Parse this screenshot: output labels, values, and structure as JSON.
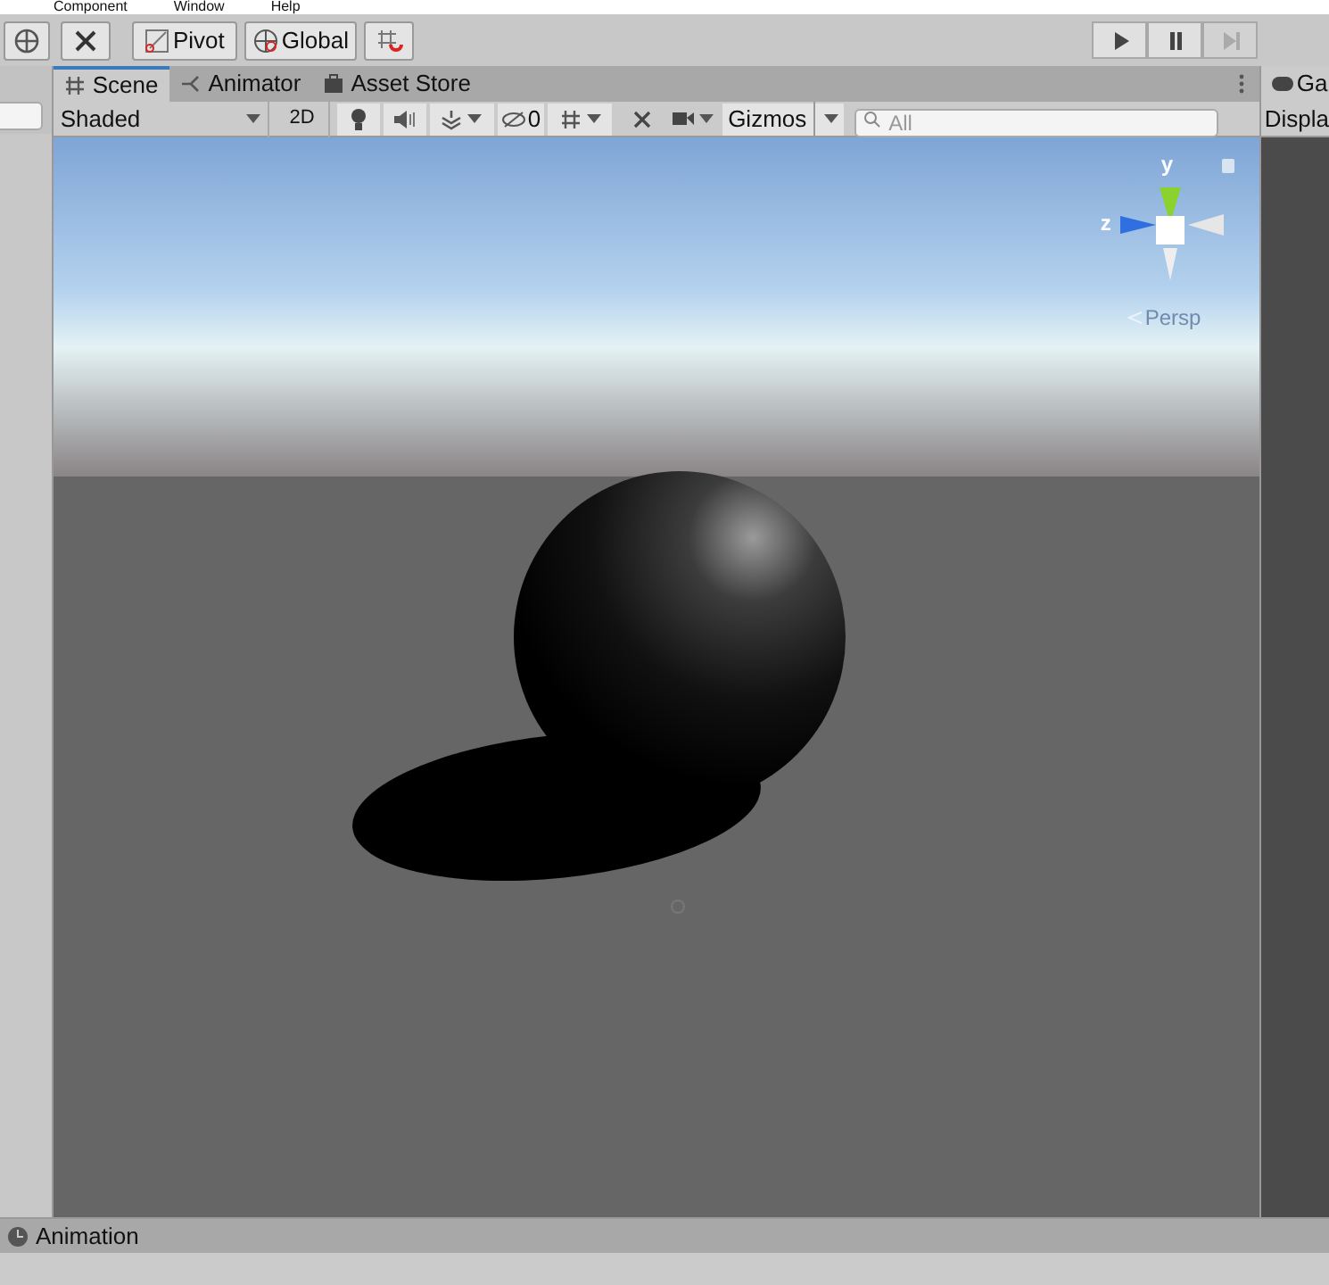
{
  "menu_bar": {
    "items": [
      "Component",
      "Window",
      "Help"
    ]
  },
  "toolbar": {
    "pivot": "Pivot",
    "global": "Global",
    "play_controls": [
      {
        "kind": "play",
        "disabled": false
      },
      {
        "kind": "pause",
        "disabled": false
      },
      {
        "kind": "step",
        "disabled": true
      }
    ]
  },
  "tabs": [
    {
      "label": "Scene",
      "kind": "scene",
      "selected": true
    },
    {
      "label": "Animator",
      "kind": "animator",
      "selected": false
    },
    {
      "label": "Asset Store",
      "kind": "store",
      "selected": false
    }
  ],
  "scene_toolbar": {
    "shading": "Shaded",
    "mode_2d": "2D",
    "hidden_count": "0",
    "gizmos": "Gizmos",
    "search": {
      "placeholder": "All"
    }
  },
  "scene_view": {
    "axis_labels": [
      "y",
      "z"
    ],
    "projection": "Persp"
  },
  "right_panel": {
    "tab": "Ga",
    "label": "Displa"
  },
  "bottom_panel": {
    "title": "Animation"
  }
}
